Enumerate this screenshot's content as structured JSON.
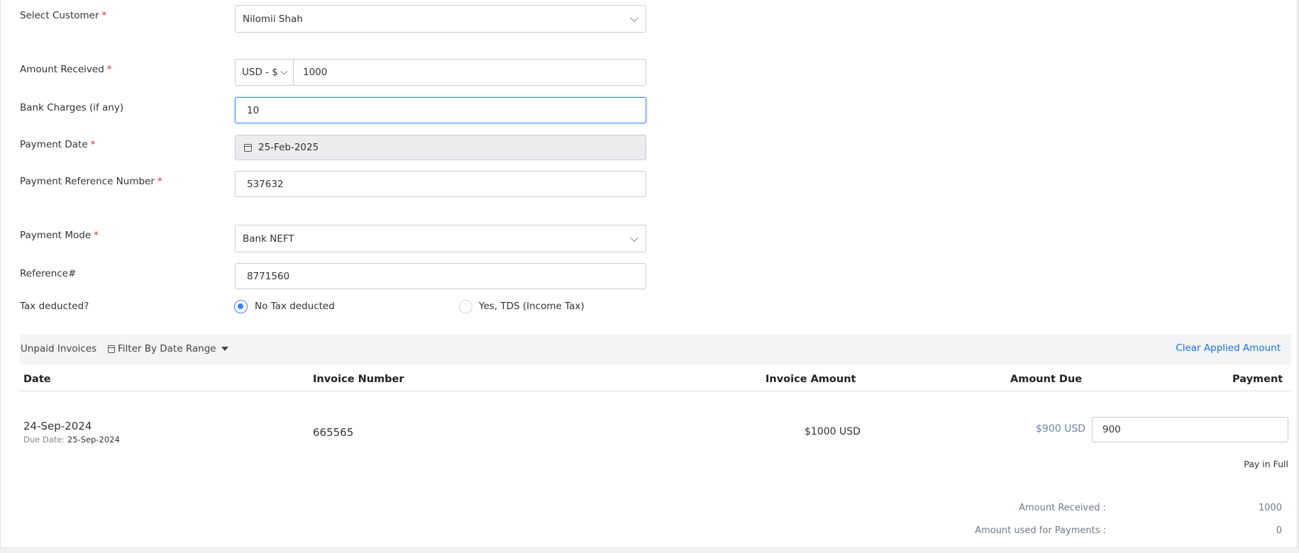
{
  "form": {
    "customer": {
      "label": "Select Customer",
      "value": "Nilomii Shah"
    },
    "amount_received": {
      "label": "Amount Received",
      "currency": "USD - $",
      "value": "1000"
    },
    "bank_charges": {
      "label": "Bank Charges (if any)",
      "value": "10"
    },
    "payment_date": {
      "label": "Payment Date",
      "value": "25-Feb-2025"
    },
    "payment_reference": {
      "label": "Payment Reference Number",
      "value": "537632"
    },
    "payment_mode": {
      "label": "Payment Mode",
      "value": "Bank NEFT"
    },
    "reference": {
      "label": "Reference#",
      "value": "8771560"
    },
    "tax": {
      "label": "Tax deducted?",
      "options": [
        {
          "label": "No Tax deducted",
          "selected": true
        },
        {
          "label": "Yes, TDS (Income Tax)",
          "selected": false
        }
      ]
    },
    "required_marker": "*"
  },
  "invoices": {
    "title": "Unpaid Invoices",
    "filter_label": "Filter By Date Range",
    "clear_label": "Clear Applied Amount",
    "columns": [
      "Date",
      "Invoice Number",
      "Invoice Amount",
      "Amount Due",
      "Payment"
    ],
    "rows": [
      {
        "date": "24-Sep-2024",
        "due_prefix": "Due Date",
        "due_date": "25-Sep-2024",
        "invoice_number": "665565",
        "invoice_amount": "$1000 USD",
        "amount_due": "$900 USD",
        "payment": "900",
        "pay_in_full": "Pay in Full"
      }
    ]
  },
  "summary": {
    "amount_received_label": "Amount Received :",
    "amount_received_value": "1000",
    "amount_used_label": "Amount used for Payments :",
    "amount_used_value": "0"
  },
  "colors": {
    "accent": "#3b82f6",
    "link": "#1a73e8",
    "required": "#d92d2d",
    "muted": "#6e85a3"
  }
}
